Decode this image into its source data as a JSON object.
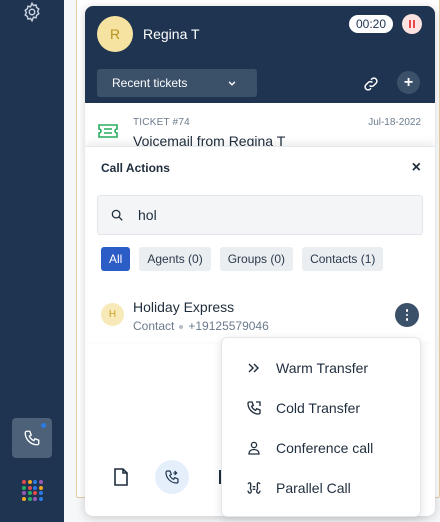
{
  "header": {
    "caller_initial": "R",
    "caller_name": "Regina T",
    "timer": "00:20",
    "recent_tickets_label": "Recent tickets"
  },
  "ticket": {
    "number": "TICKET #74",
    "date": "Jul-18-2022",
    "title": "Voicemail from Regina T"
  },
  "call_actions": {
    "title": "Call Actions",
    "close_label": "×",
    "search_value": "hol",
    "filters": [
      {
        "label": "All",
        "active": true
      },
      {
        "label": "Agents (0)",
        "active": false
      },
      {
        "label": "Groups (0)",
        "active": false
      },
      {
        "label": "Contacts (1)",
        "active": false
      }
    ],
    "result": {
      "initial": "H",
      "name": "Holiday Express",
      "type": "Contact",
      "phone": "+19125579046"
    }
  },
  "transfer_menu": {
    "items": [
      {
        "label": "Warm Transfer",
        "icon": "double-chevron-right-icon"
      },
      {
        "label": "Cold Transfer",
        "icon": "phone-forward-icon"
      },
      {
        "label": "Conference call",
        "icon": "person-icon"
      },
      {
        "label": "Parallel Call",
        "icon": "phone-parallel-icon"
      }
    ]
  },
  "colors": {
    "rail": "#1f3450",
    "header": "#1f3450",
    "accent": "#2c5cc5",
    "avatar_bg": "#f7e3a1",
    "end_call": "#e5484d"
  },
  "rail": {
    "app_dot_colors": [
      "#e5484d",
      "#f5a623",
      "#2c7be5",
      "#9b59b6",
      "#27ae60",
      "#e5484d",
      "#2c7be5",
      "#f5a623",
      "#9b59b6",
      "#27ae60",
      "#e5484d",
      "#2c7be5",
      "#f5a623",
      "#27ae60",
      "#9b59b6",
      "#2c7be5"
    ]
  }
}
